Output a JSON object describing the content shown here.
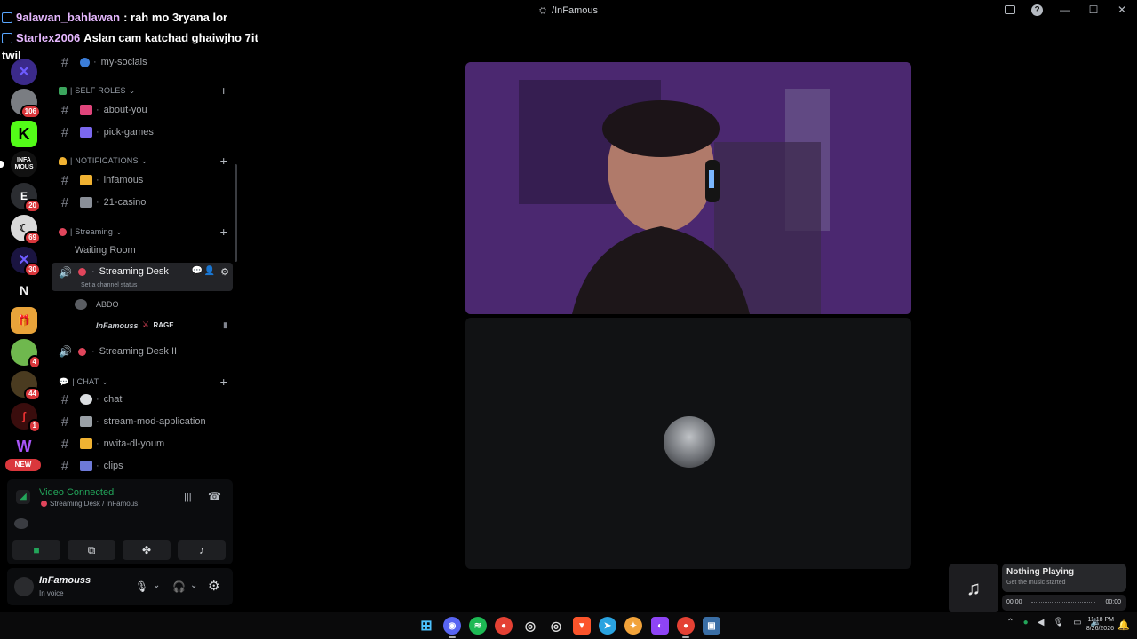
{
  "window": {
    "title": "/InFamous"
  },
  "overlay_chat": [
    {
      "user": "9alawan_bahlawan",
      "text": ": rah mo 3ryana lor"
    },
    {
      "user": "Starlex2006",
      "text": "Aslan cam katchad ghaiwjho 7it"
    },
    {
      "user": "twil",
      "text": ""
    }
  ],
  "server_rail": {
    "badges": [
      "106",
      "20",
      "69",
      "30",
      "4",
      "44",
      "1"
    ],
    "new_label": "NEW",
    "infamous_label": "INFA\nMOUS"
  },
  "sidebar": {
    "channels_top": {
      "name": "my-socials"
    },
    "cat_self_roles": "| SELF ROLES",
    "ch_about_you": "about-you",
    "ch_pick_games": "pick-games",
    "cat_notifications": "| NOTIFICATIONS",
    "ch_infamous": "infamous",
    "ch_21_casino": "21-casino",
    "cat_streaming": "| Streaming",
    "ch_waiting_room": "Waiting Room",
    "ch_streaming_desk": "Streaming Desk",
    "ch_streaming_desk_status": "Set a channel status",
    "vc_user_1": "ABDO",
    "vc_user_2": "InFamouss",
    "vc_user_2_tag": "RAGE",
    "ch_streaming_desk_2": "Streaming Desk II",
    "cat_chat": "| CHAT",
    "ch_chat": "chat",
    "ch_stream_mod": "stream-mod-application",
    "ch_nwita": "nwita-dl-youm",
    "ch_clips": "clips"
  },
  "voice_panel": {
    "title": "Video Connected",
    "subtitle": "Streaming Desk / InFamous"
  },
  "user_panel": {
    "name": "InFamouss",
    "status": "In voice"
  },
  "music": {
    "title": "Nothing Playing",
    "subtitle": "Get the music started",
    "time_start": "00:00",
    "time_end": "00:00"
  },
  "clock": {
    "time": "11:18 PM",
    "date": "8/26/2026"
  },
  "colors": {
    "accent_green": "#23a55a",
    "badge_red": "#da373c",
    "live_dot": "#e0455b"
  }
}
